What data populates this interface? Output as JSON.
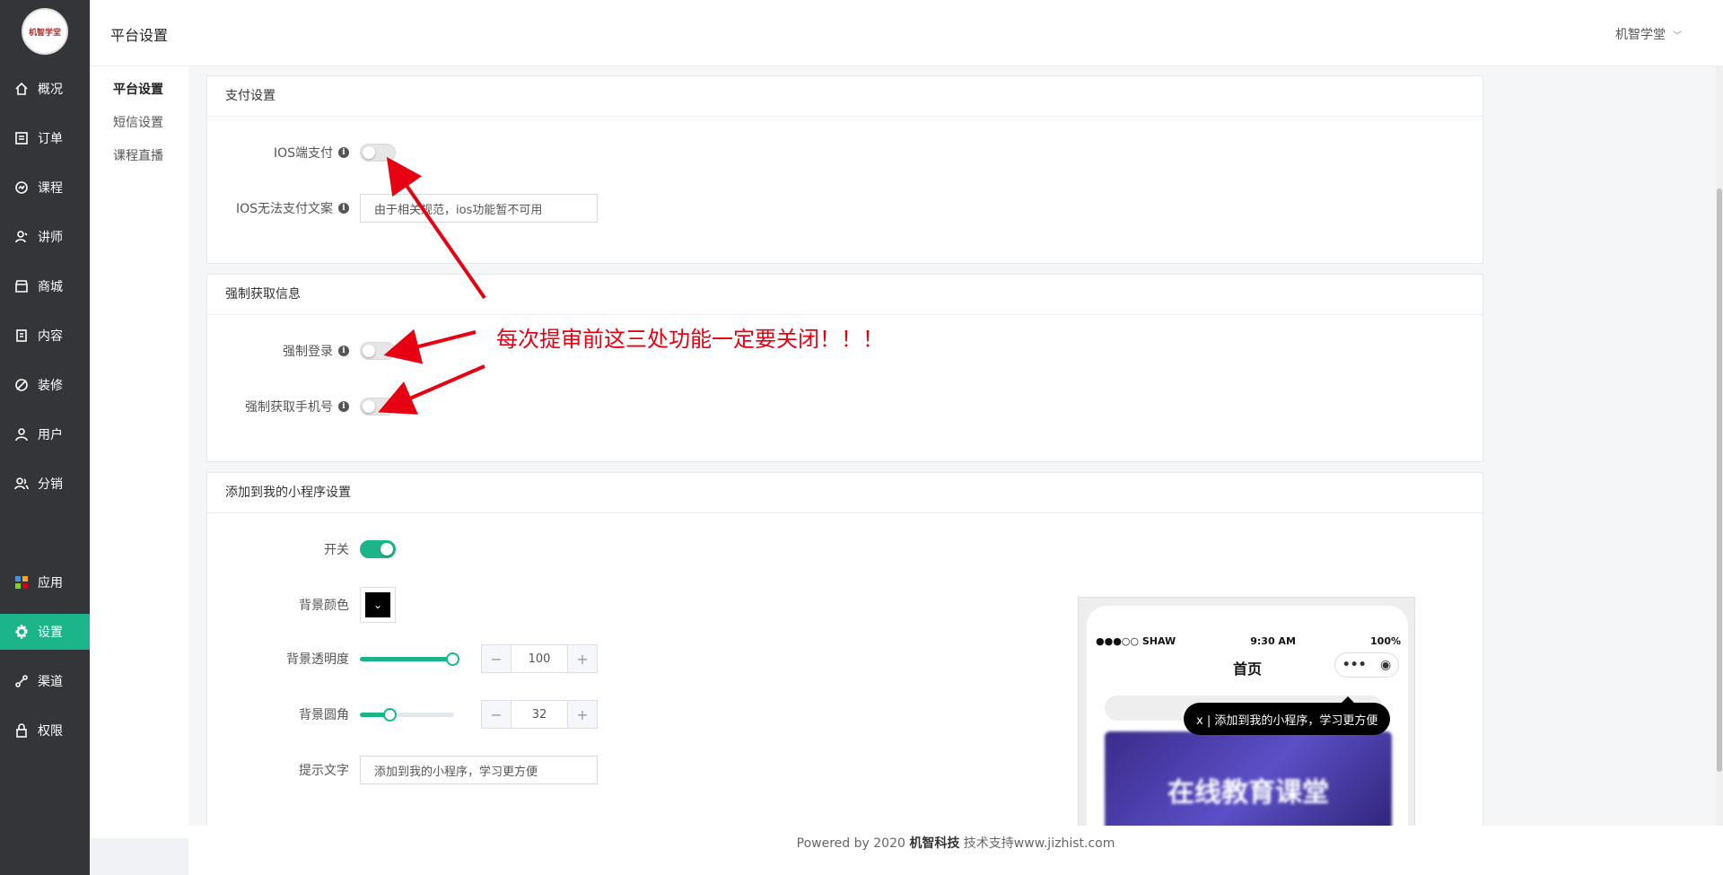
{
  "logo_text": "机智学堂",
  "sidebar": {
    "items": [
      {
        "label": "概况",
        "icon": "home-icon"
      },
      {
        "label": "订单",
        "icon": "order-icon"
      },
      {
        "label": "课程",
        "icon": "course-icon"
      },
      {
        "label": "讲师",
        "icon": "teacher-icon"
      },
      {
        "label": "商城",
        "icon": "store-icon"
      },
      {
        "label": "内容",
        "icon": "content-icon"
      },
      {
        "label": "装修",
        "icon": "decorate-icon"
      },
      {
        "label": "用户",
        "icon": "user-icon"
      },
      {
        "label": "分销",
        "icon": "distribution-icon"
      },
      {
        "label": "应用",
        "icon": "apps-icon"
      },
      {
        "label": "设置",
        "icon": "gear-icon",
        "active": true
      },
      {
        "label": "渠道",
        "icon": "channel-icon"
      },
      {
        "label": "权限",
        "icon": "lock-icon"
      }
    ]
  },
  "header": {
    "title": "平台设置",
    "user": "机智学堂"
  },
  "subnav": {
    "items": [
      "平台设置",
      "短信设置",
      "课程直播"
    ]
  },
  "payment": {
    "title": "支付设置",
    "ios_pay_label": "IOS端支付",
    "ios_text_label": "IOS无法支付文案",
    "ios_text_value": "由于相关规范，ios功能暂不可用"
  },
  "force": {
    "title": "强制获取信息",
    "login_label": "强制登录",
    "phone_label": "强制获取手机号"
  },
  "miniapp": {
    "title": "添加到我的小程序设置",
    "switch_label": "开关",
    "bg_color_label": "背景颜色",
    "opacity_label": "背景透明度",
    "opacity_value": "100",
    "radius_label": "背景圆角",
    "radius_value": "32",
    "tip_label": "提示文字",
    "tip_value": "添加到我的小程序，学习更方便"
  },
  "phone": {
    "carrier": "●●●○○ SHAW",
    "time": "9:30 AM",
    "battery": "100%",
    "title": "首页",
    "tip": "x | 添加到我的小程序，学习更方便",
    "banner": "在线教育课堂"
  },
  "annotation": "每次提审前这三处功能一定要关闭！！！",
  "footer": {
    "powered": "Powered by 2020",
    "company": "机智科技",
    "support": "技术支持www.jizhist.com"
  },
  "colors": {
    "accent": "#1cb589",
    "sidebar": "#333538",
    "annotation": "#e60012"
  }
}
